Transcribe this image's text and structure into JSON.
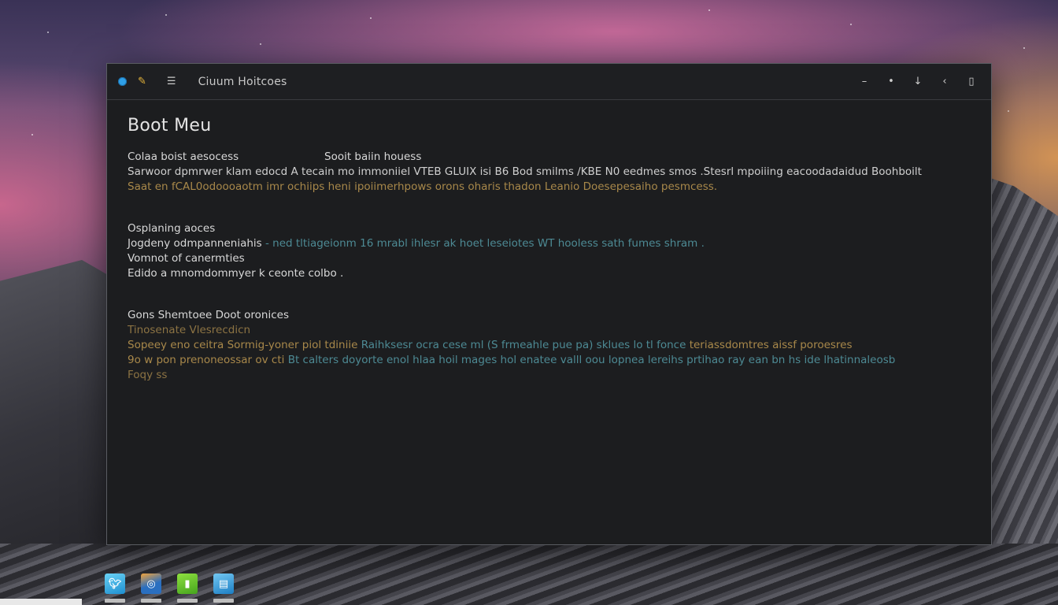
{
  "window": {
    "title": "Ciuum Hoitcoes",
    "controls": {
      "minimize": "–",
      "dot": "•",
      "down": "↓",
      "back": "‹",
      "close": "▯"
    }
  },
  "content": {
    "heading": "Boot Meu",
    "section1": {
      "label_a": "Colaa boist aesocess",
      "label_b": "Sooit baiin houess",
      "line1": "Sarwoor dpmrwer klam edocd A tecain mo immoniiel VTEB GLUIX isi B6 Bod smilms /KBE N0 eedmes smos .Stesrl mpoiiing eacoodadaidud Boohboilt",
      "line2": "Saat en fCAL0odoooaotm imr ochiips heni ipoiimerhpows orons oharis thadon Leanio Doesepesaiho pesmcess."
    },
    "section2": {
      "label": "Osplaning aoces",
      "line1_a": "Jogdeny odmpanneniahis",
      "line1_b": "- ned tltiageionm 16 mrabl ihlesr ak hoet leseiotes WT hooless sath fumes shram .",
      "line2": "Vomnot of canermties",
      "line3": "Edido a mnomdommyer k ceonte colbo ."
    },
    "section3": {
      "label": "Gons Shemtoee Doot oronices",
      "line1": "Tinosenate Vlesrecdicn",
      "line2_a": "Sopeey eno ceitra Sormig-yoner piol tdiniie",
      "line2_b": "Raihksesr ocra cese ml (S frmeahle pue pa) sklues lo tl fonce",
      "line2_c": "teriassdomtres aissf poroesres",
      "line3_a": "9o w pon prenoneossar ov cti",
      "line3_b": "Bt calters doyorte enol hlaa hoil mages hol enatee valll oou lopnea lereihs prtihao ray ean bn hs ide lhatinnaleosb",
      "line4": "Foqy ss"
    }
  },
  "dock": {
    "icons": [
      "bird-icon",
      "browser-icon",
      "phone-icon",
      "notes-icon"
    ]
  },
  "colors": {
    "window_bg": "#1c1d1f",
    "accent_amber": "#a8884a",
    "accent_teal": "#4d8a94",
    "dot_blue": "#2fa0e8"
  }
}
